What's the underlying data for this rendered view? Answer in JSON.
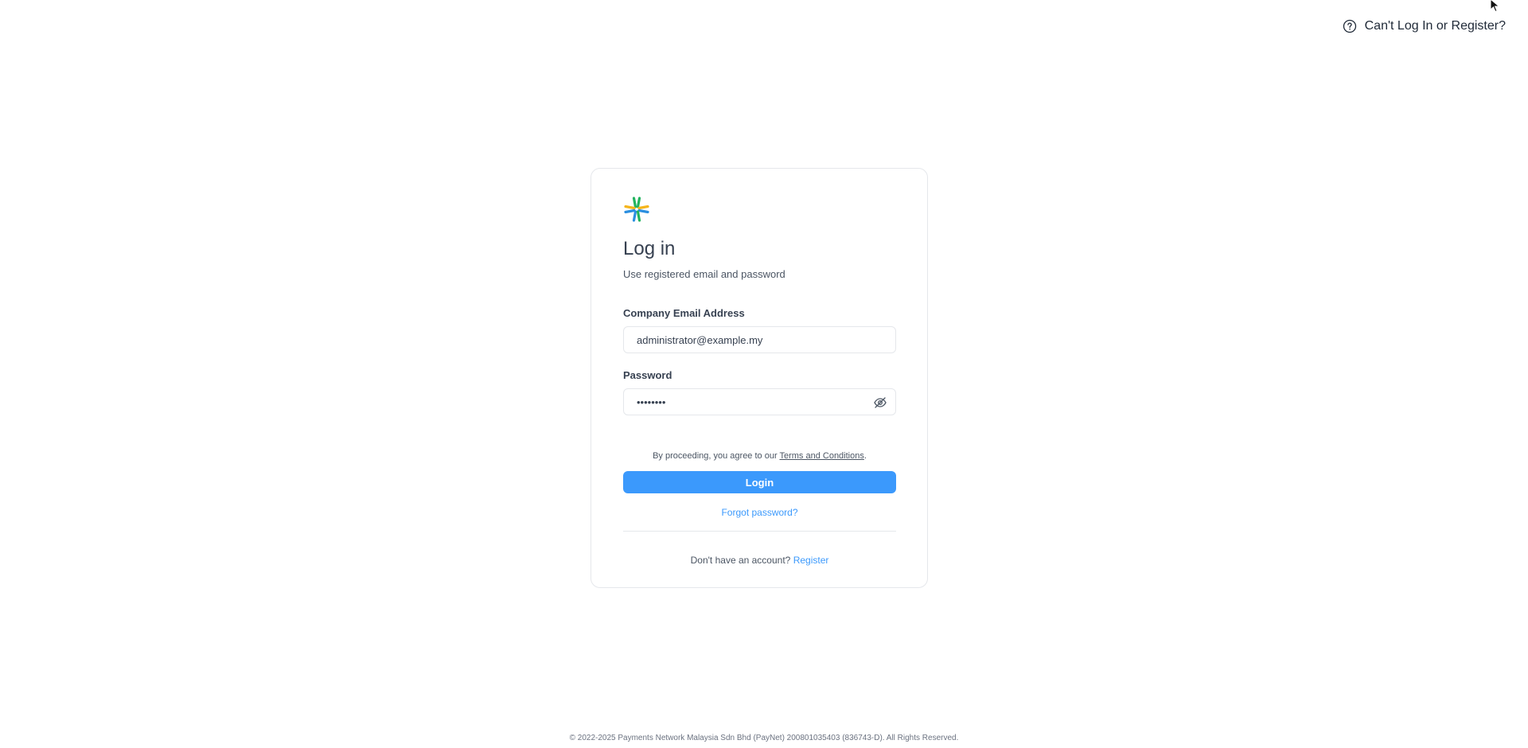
{
  "header": {
    "help_link_label": "Can't Log In or Register?"
  },
  "login_card": {
    "title": "Log in",
    "subtitle": "Use registered email and password",
    "email": {
      "label": "Company Email Address",
      "value": "administrator@example.my"
    },
    "password": {
      "label": "Password",
      "value": "passw0rd"
    },
    "terms_prefix": "By proceeding, you agree to our ",
    "terms_link": "Terms and Conditions",
    "terms_suffix": ".",
    "login_button": "Login",
    "forgot_password": "Forgot password?",
    "no_account_text": "Don't have an account?",
    "register_link": "Register"
  },
  "footer": {
    "copyright": "© 2022-2025 Payments Network Malaysia Sdn Bhd (PayNet) 200801035403 (836743-D). All Rights Reserved."
  },
  "colors": {
    "accent": "#3b99fc",
    "logo_green": "#22b35e",
    "logo_blue": "#2b8fe0",
    "logo_yellow": "#f5b51c"
  },
  "icons": {
    "help": "question-circle-icon",
    "password_toggle": "eye-slash-icon",
    "logo": "paynet-logo"
  }
}
